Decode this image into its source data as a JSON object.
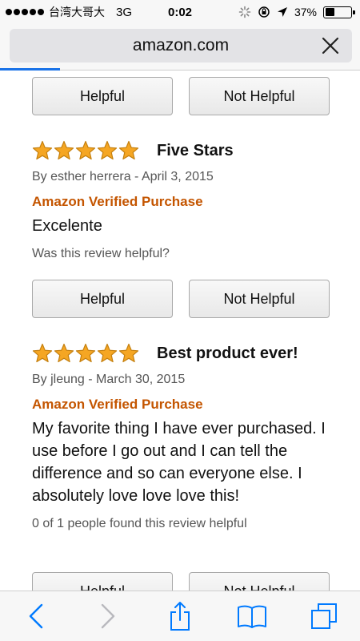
{
  "status_bar": {
    "carrier": "台湾大哥大",
    "network": "3G",
    "time": "0:02",
    "battery": "37%",
    "battery_level": 0.37
  },
  "browser": {
    "url": "amazon.com",
    "accent_color": "#1a73e8"
  },
  "helpful_label": "Helpful",
  "not_helpful_label": "Not Helpful",
  "reviews": [
    {
      "rating": 5,
      "title": "Five Stars",
      "byline": "By esther herrera - April 3, 2015",
      "verified": "Amazon Verified Purchase",
      "body": "Excelente",
      "helpful_prompt": "Was this review helpful?"
    },
    {
      "rating": 5,
      "title": "Best product ever!",
      "byline": "By jleung - March 30, 2015",
      "verified": "Amazon Verified Purchase",
      "body": "My favorite thing I have ever purchased. I use before I go out and I can tell the difference and so can everyone else. I absolutely love love love this!",
      "helpful_prompt": "0 of 1 people found this review helpful"
    }
  ],
  "colors": {
    "star": "#f5a623",
    "verified": "#c45500",
    "ios_blue": "#007aff"
  },
  "toolbar_icons": [
    "back-icon",
    "forward-icon",
    "share-icon",
    "bookmarks-icon",
    "tabs-icon"
  ]
}
